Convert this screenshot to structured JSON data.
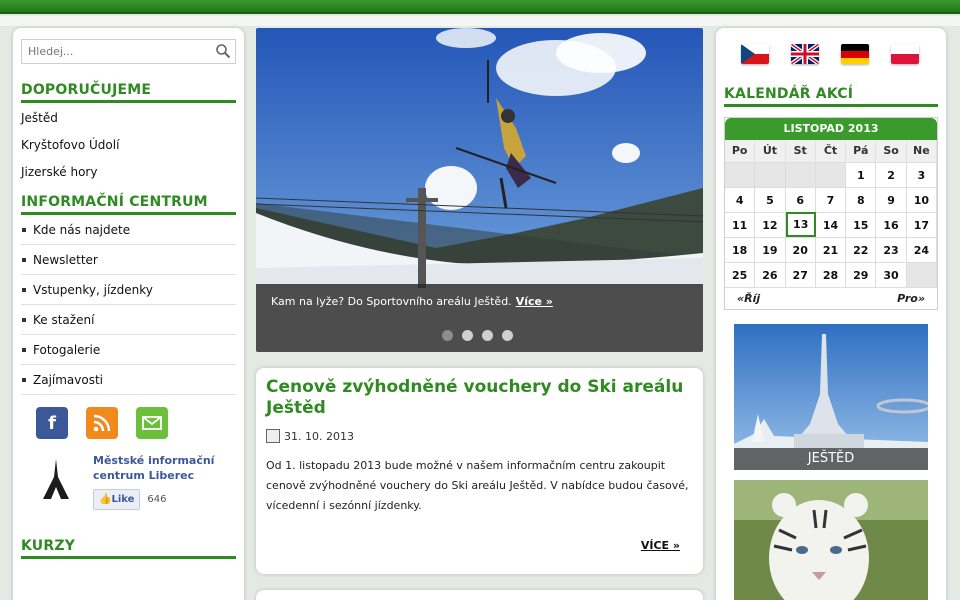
{
  "search": {
    "placeholder": "Hledej..."
  },
  "recommend": {
    "title": "DOPORUČUJEME",
    "items": [
      "Ještěd",
      "Kryštofovo Údolí",
      "Jizerské hory"
    ]
  },
  "info": {
    "title": "INFORMAČNÍ CENTRUM",
    "items": [
      "Kde nás najdete",
      "Newsletter",
      "Vstupenky, jízdenky",
      "Ke stažení",
      "Fotogalerie",
      "Zajímavosti"
    ]
  },
  "social": {
    "facebook": "f",
    "rss": "rss-icon",
    "mail": "mail-icon"
  },
  "fb_widget": {
    "name_line1": "Městské informační",
    "name_line2": "centrum Liberec",
    "like_label": "Like",
    "like_count": "646"
  },
  "courses": {
    "title": "KURZY"
  },
  "slider": {
    "caption": "Kam na lyže? Do Sportovního areálu Ještěd.",
    "more": "Více »",
    "slides": 4,
    "active": 1
  },
  "article": {
    "title": "Cenově zvýhodněné vouchery do Ski areálu Ještěd",
    "date": "31. 10. 2013",
    "body": "Od 1. listopadu 2013 bude možné v našem informačním centru zakoupit cenově zvýhodněné vouchery do Ski areálu Ještěd. V nabídce budou časové, vícedenní i sezónní jízdenky.",
    "more": "VÍCE »"
  },
  "calendar": {
    "title": "KALENDÁŘ AKCÍ",
    "month": "LISTOPAD 2013",
    "days": [
      "Po",
      "Út",
      "St",
      "Čt",
      "Pá",
      "So",
      "Ne"
    ],
    "weeks": [
      [
        "",
        "",
        "",
        "",
        "1",
        "2",
        "3"
      ],
      [
        "4",
        "5",
        "6",
        "7",
        "8",
        "9",
        "10"
      ],
      [
        "11",
        "12",
        "13",
        "14",
        "15",
        "16",
        "17"
      ],
      [
        "18",
        "19",
        "20",
        "21",
        "22",
        "23",
        "24"
      ],
      [
        "25",
        "26",
        "27",
        "28",
        "29",
        "30",
        ""
      ]
    ],
    "today": "13",
    "prev": "«Říj",
    "next": "Pro»"
  },
  "promo": {
    "label": "JEŠTĚD"
  },
  "colors": {
    "accent": "#2f8a22",
    "topbar": "#21751a"
  }
}
